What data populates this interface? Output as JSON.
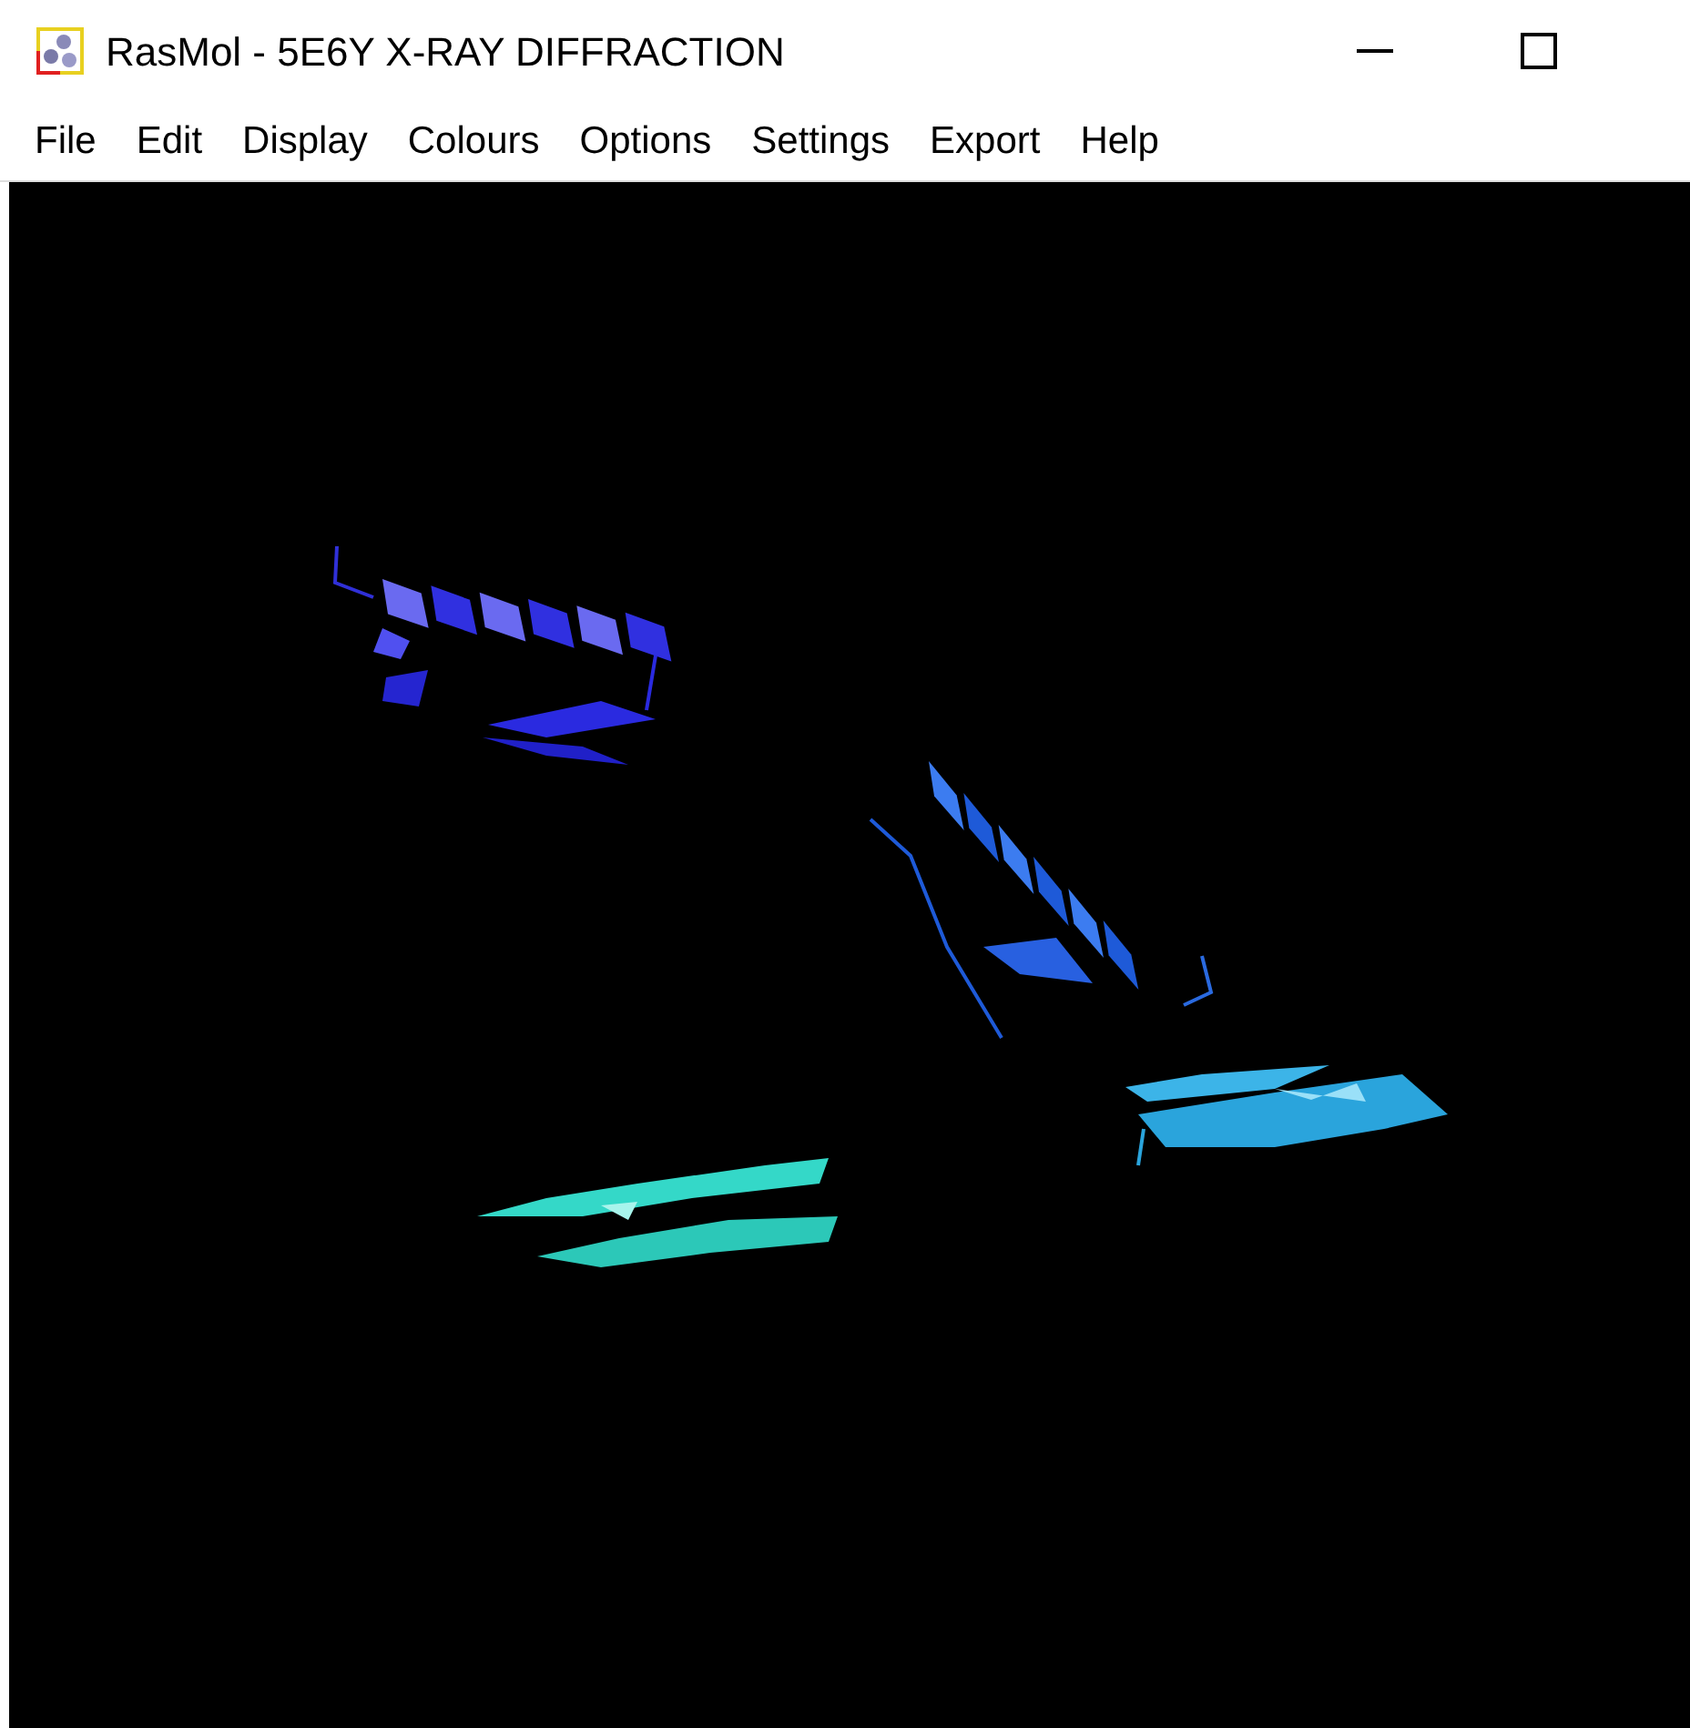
{
  "window": {
    "title": "RasMol - 5E6Y X-RAY DIFFRACTION"
  },
  "menu": [
    {
      "label": "File"
    },
    {
      "label": "Edit"
    },
    {
      "label": "Display"
    },
    {
      "label": "Colours"
    },
    {
      "label": "Options"
    },
    {
      "label": "Settings"
    },
    {
      "label": "Export"
    },
    {
      "label": "Help"
    }
  ]
}
